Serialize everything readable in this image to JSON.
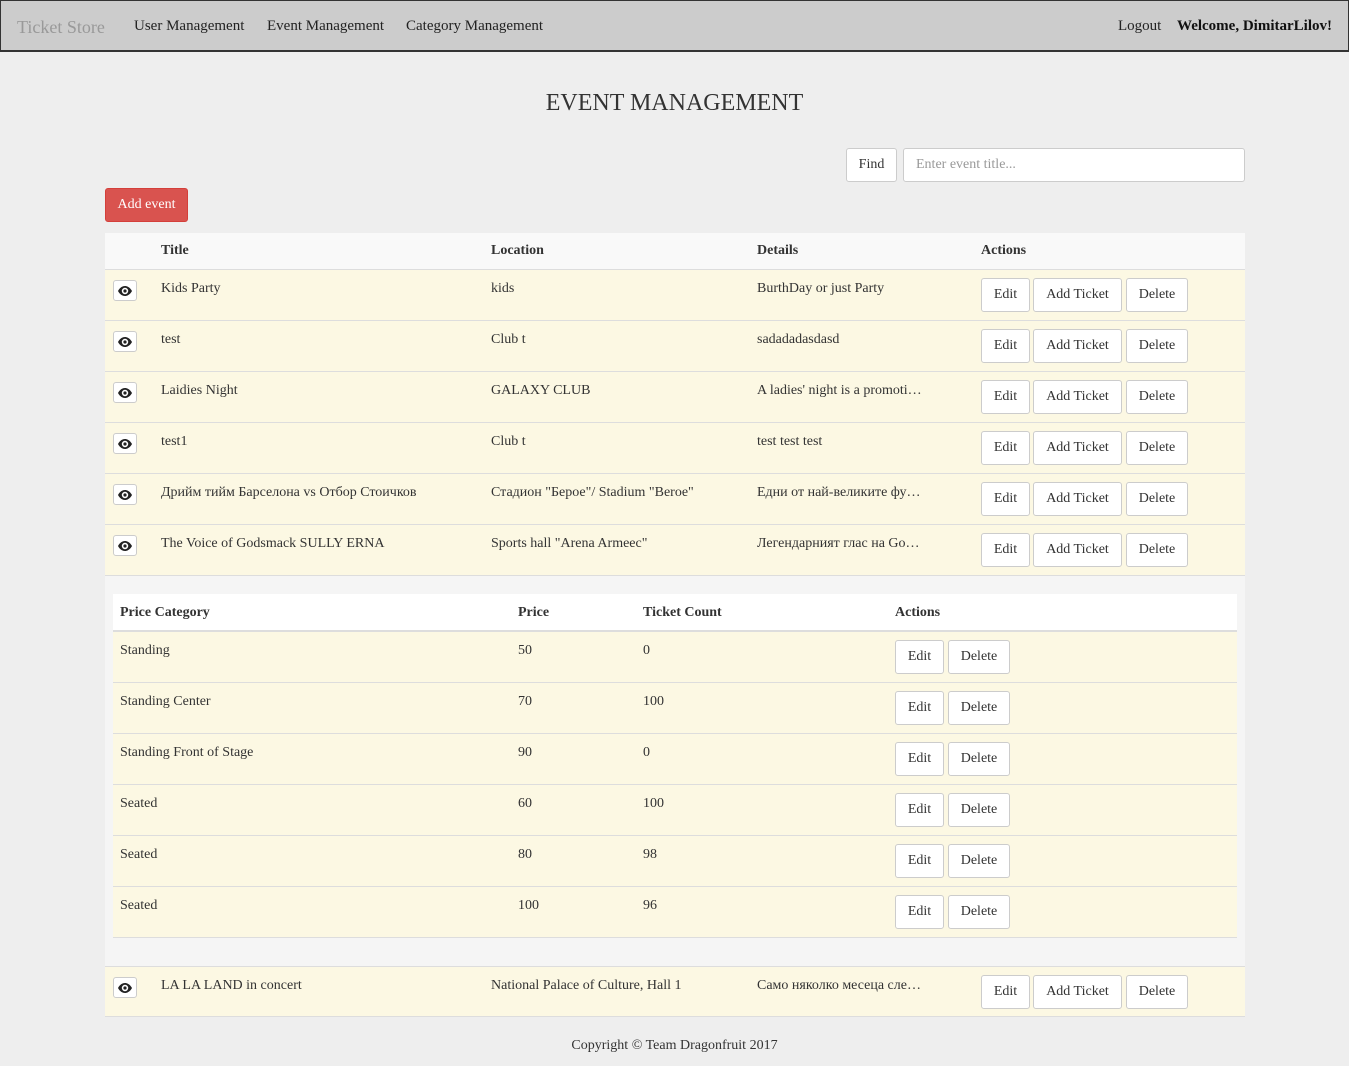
{
  "navbar": {
    "brand": "Ticket Store",
    "links": [
      "User Management",
      "Event Management",
      "Category Management"
    ],
    "logout": "Logout",
    "welcome": "Welcome, DimitarLilov!"
  },
  "page": {
    "title": "EVENT MANAGEMENT",
    "find_label": "Find",
    "search_placeholder": "Enter event title...",
    "add_event_label": "Add event"
  },
  "events_table": {
    "headers": [
      "Title",
      "Location",
      "Details",
      "Actions"
    ],
    "buttons": {
      "edit": "Edit",
      "add_ticket": "Add Ticket",
      "delete": "Delete"
    },
    "rows": [
      {
        "title": "Kids Party",
        "location": "kids",
        "details": "BurthDay or just Party"
      },
      {
        "title": "test",
        "location": "Club t",
        "details": "sadadadasdasd"
      },
      {
        "title": "Laidies Night",
        "location": "GALAXY CLUB",
        "details": "A ladies' night is a promoti…"
      },
      {
        "title": "test1",
        "location": "Club t",
        "details": "test test test"
      },
      {
        "title": "Дрийм тийм Барселона vs Отбор Стоичков",
        "location": "Стадион \"Берое\"/ Stadium \"Beroe\"",
        "details": "Едни от най-великите фу…"
      },
      {
        "title": "The Voice of Godsmack SULLY ERNA",
        "location": "Sports hall \"Arena Armeec\"",
        "details": "Легендарният глас на Go…"
      }
    ],
    "last_row": {
      "title": "LA LA LAND in concert",
      "location": "National Palace of Culture, Hall 1",
      "details": "Само няколко месеца сле…"
    }
  },
  "tickets_table": {
    "headers": [
      "Price Category",
      "Price",
      "Ticket Count",
      "Actions"
    ],
    "buttons": {
      "edit": "Edit",
      "delete": "Delete"
    },
    "rows": [
      {
        "category": "Standing",
        "price": "50",
        "count": "0"
      },
      {
        "category": "Standing Center",
        "price": "70",
        "count": "100"
      },
      {
        "category": "Standing Front of Stage",
        "price": "90",
        "count": "0"
      },
      {
        "category": "Seated",
        "price": "60",
        "count": "100"
      },
      {
        "category": "Seated",
        "price": "80",
        "count": "98"
      },
      {
        "category": "Seated",
        "price": "100",
        "count": "96"
      }
    ]
  },
  "footer": {
    "text": "Copyright © Team Dragonfruit 2017"
  },
  "colors": {
    "danger": "#d9534f",
    "warning_row": "#fcf8e3",
    "navbar": "#cccccc",
    "background": "#eeeeee"
  },
  "icons": {
    "view": "eye-icon"
  }
}
